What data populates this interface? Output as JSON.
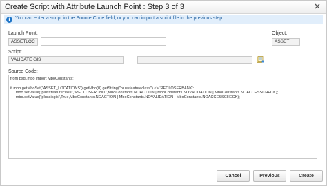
{
  "dialog": {
    "title": "Create Script with Attribute Launch Point : Step 3 of 3",
    "info": "You can enter a script in the Source Code field, or you can import a script file in the previous step."
  },
  "form": {
    "launch_point_label": "Launch Point:",
    "launch_point_value": "ASSETLOC",
    "launch_point_desc": "",
    "object_label": "Object:",
    "object_value": "ASSET",
    "script_label": "Script:",
    "script_value": "VALIDATE GIS",
    "script_desc": "",
    "source_code_label": "Source Code:",
    "source_code": "from psdi.mbo import MboConstants;\n\nif mbo.getMboSet(\"ASSET_LOCATIONS\").getMbo(0).getString(\"plussfeatureclass\") <> 'RECLOSERBANK':\n     mbo.setValue(\"plussfeatureclass\",\"RECLOSERUNIT\",MboConstants.NOACTION | MboConstants.NOVALIDATION | MboConstants.NOACCESSCHECK);\n     mbo.setValue(\"plussisgis\",True,MboConstants.NOACTION | MboConstants.NOVALIDATION | MboConstants.NOACCESSCHECK);"
  },
  "buttons": {
    "cancel": "Cancel",
    "previous": "Previous",
    "create": "Create"
  },
  "icons": {
    "close": "close-icon",
    "info": "info-icon",
    "attach": "attachment-icon"
  },
  "colors": {
    "info_bar": "#e1eefb",
    "info_icon": "#1f75c7",
    "info_text": "#1f5f9f"
  }
}
